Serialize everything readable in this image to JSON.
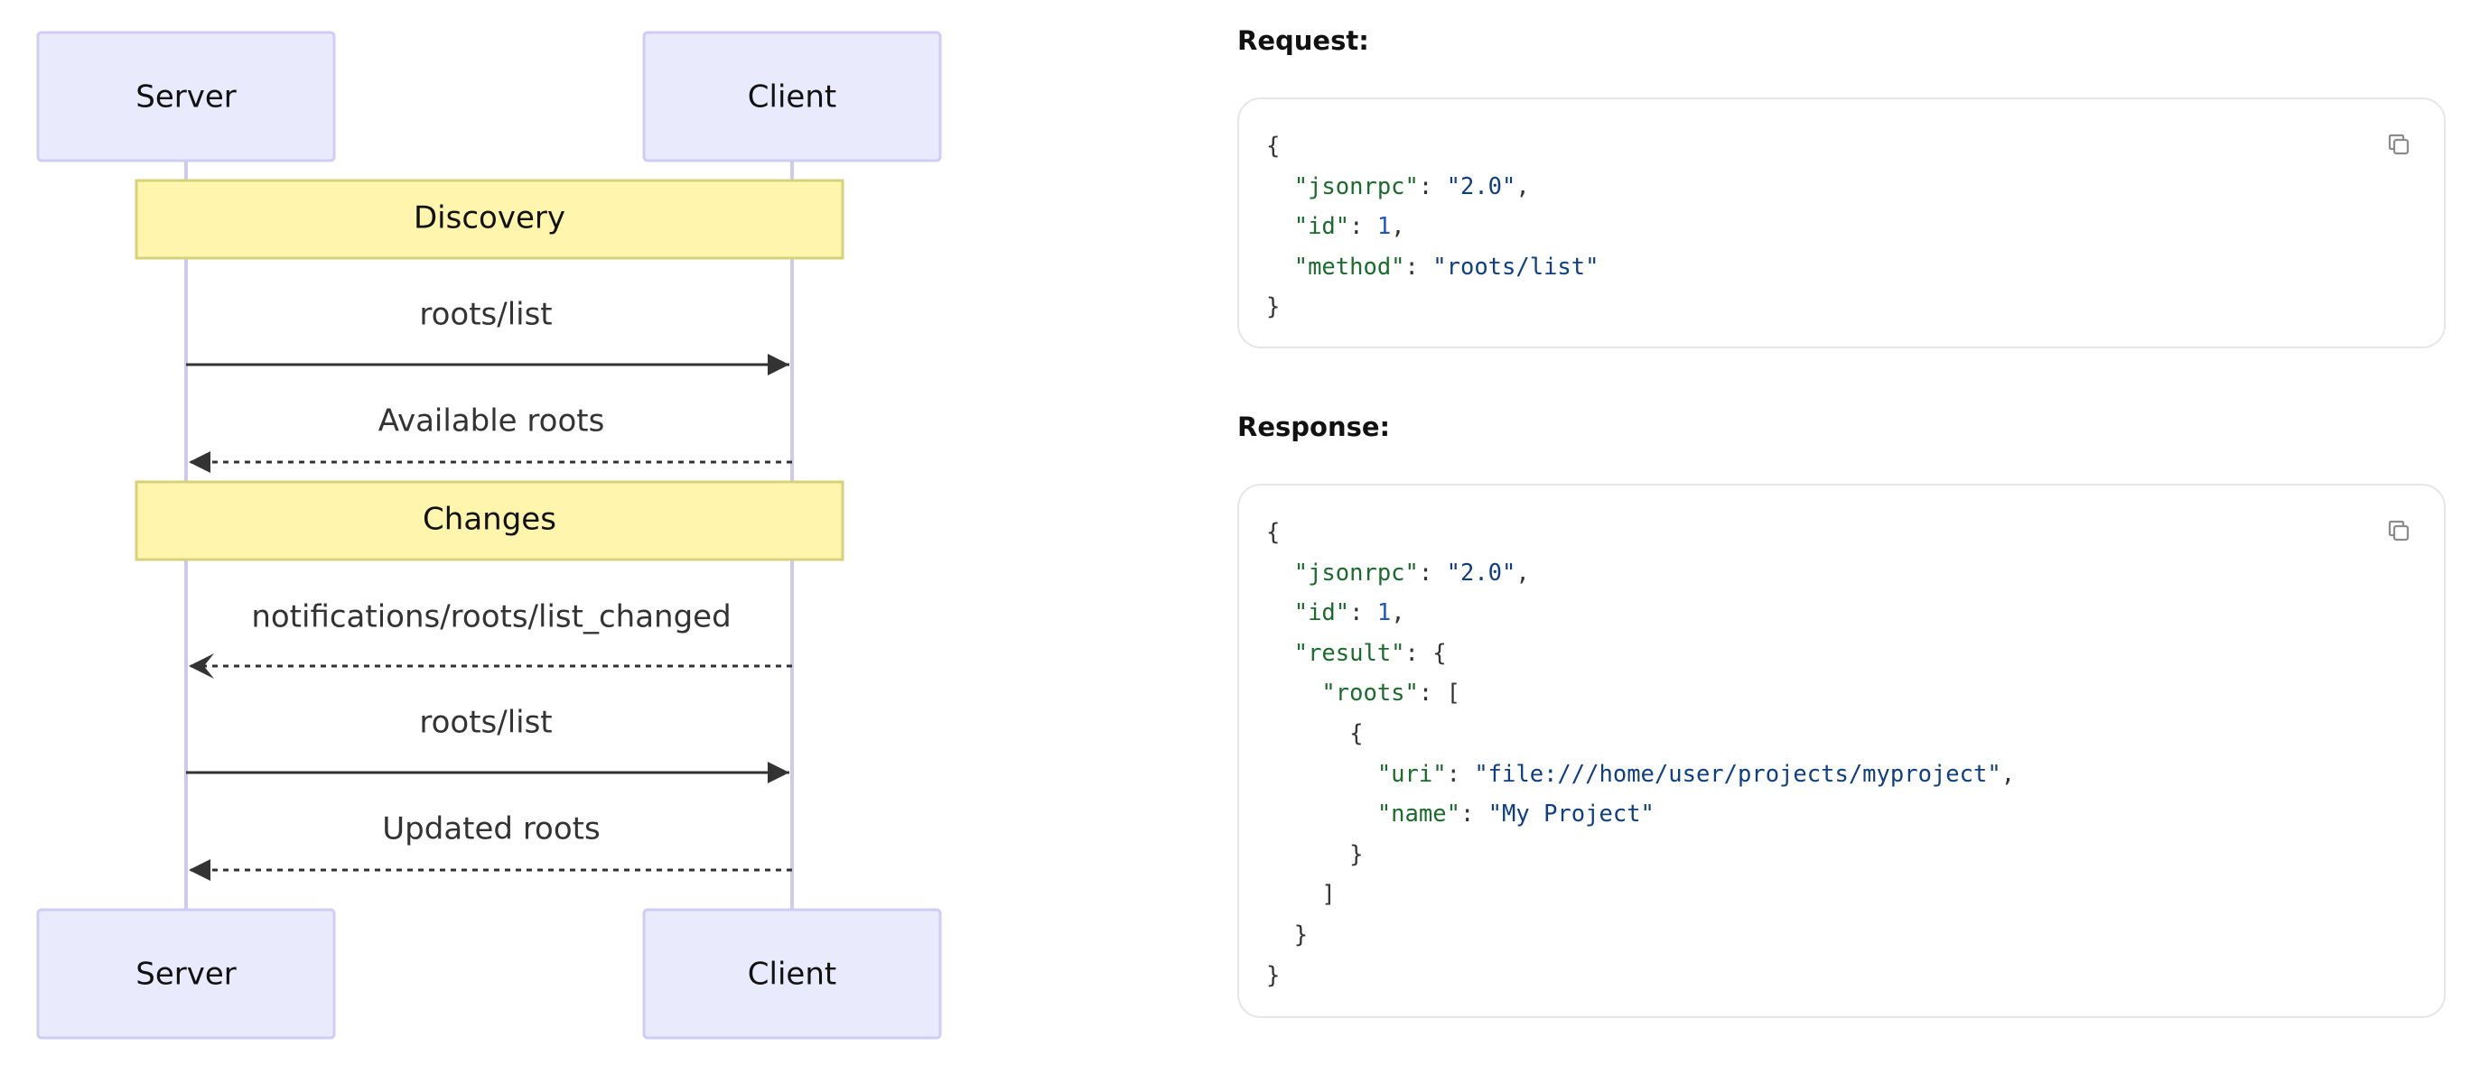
{
  "diagram": {
    "participants": {
      "server": "Server",
      "client": "Client"
    },
    "notes": {
      "discovery": "Discovery",
      "changes": "Changes"
    },
    "messages": {
      "m1": "roots/list",
      "m2": "Available roots",
      "m3": "notifications/roots/list_changed",
      "m4": "roots/list",
      "m5": "Updated roots"
    }
  },
  "request": {
    "label": "Request:",
    "lines": [
      [
        [
          "p",
          "{"
        ]
      ],
      [
        [
          "p",
          "  "
        ],
        [
          "k",
          "\"jsonrpc\""
        ],
        [
          "p",
          ": "
        ],
        [
          "s",
          "\"2.0\""
        ],
        [
          "p",
          ","
        ]
      ],
      [
        [
          "p",
          "  "
        ],
        [
          "k",
          "\"id\""
        ],
        [
          "p",
          ": "
        ],
        [
          "n",
          "1"
        ],
        [
          "p",
          ","
        ]
      ],
      [
        [
          "p",
          "  "
        ],
        [
          "k",
          "\"method\""
        ],
        [
          "p",
          ": "
        ],
        [
          "s",
          "\"roots/list\""
        ]
      ],
      [
        [
          "p",
          "}"
        ]
      ]
    ]
  },
  "response": {
    "label": "Response:",
    "lines": [
      [
        [
          "p",
          "{"
        ]
      ],
      [
        [
          "p",
          "  "
        ],
        [
          "k",
          "\"jsonrpc\""
        ],
        [
          "p",
          ": "
        ],
        [
          "s",
          "\"2.0\""
        ],
        [
          "p",
          ","
        ]
      ],
      [
        [
          "p",
          "  "
        ],
        [
          "k",
          "\"id\""
        ],
        [
          "p",
          ": "
        ],
        [
          "n",
          "1"
        ],
        [
          "p",
          ","
        ]
      ],
      [
        [
          "p",
          "  "
        ],
        [
          "k",
          "\"result\""
        ],
        [
          "p",
          ": {"
        ]
      ],
      [
        [
          "p",
          "    "
        ],
        [
          "k",
          "\"roots\""
        ],
        [
          "p",
          ": ["
        ]
      ],
      [
        [
          "p",
          "      {"
        ]
      ],
      [
        [
          "p",
          "        "
        ],
        [
          "k",
          "\"uri\""
        ],
        [
          "p",
          ": "
        ],
        [
          "s",
          "\"file:///home/user/projects/myproject\""
        ],
        [
          "p",
          ","
        ]
      ],
      [
        [
          "p",
          "        "
        ],
        [
          "k",
          "\"name\""
        ],
        [
          "p",
          ": "
        ],
        [
          "s",
          "\"My Project\""
        ]
      ],
      [
        [
          "p",
          "      }"
        ]
      ],
      [
        [
          "p",
          "    ]"
        ]
      ],
      [
        [
          "p",
          "  }"
        ]
      ],
      [
        [
          "p",
          "}"
        ]
      ]
    ]
  },
  "icons": {
    "copy": "copy-icon"
  },
  "colors": {
    "actor_fill": "#eaeafd",
    "actor_border": "#d0ccf5",
    "lifeline": "#cfc9f0",
    "note_fill": "#fff5ad",
    "note_border": "#d6d27a",
    "arrow": "#333333",
    "json_key": "#1a6b2c",
    "json_string": "#0e3f82",
    "json_number": "#1b56c4"
  }
}
